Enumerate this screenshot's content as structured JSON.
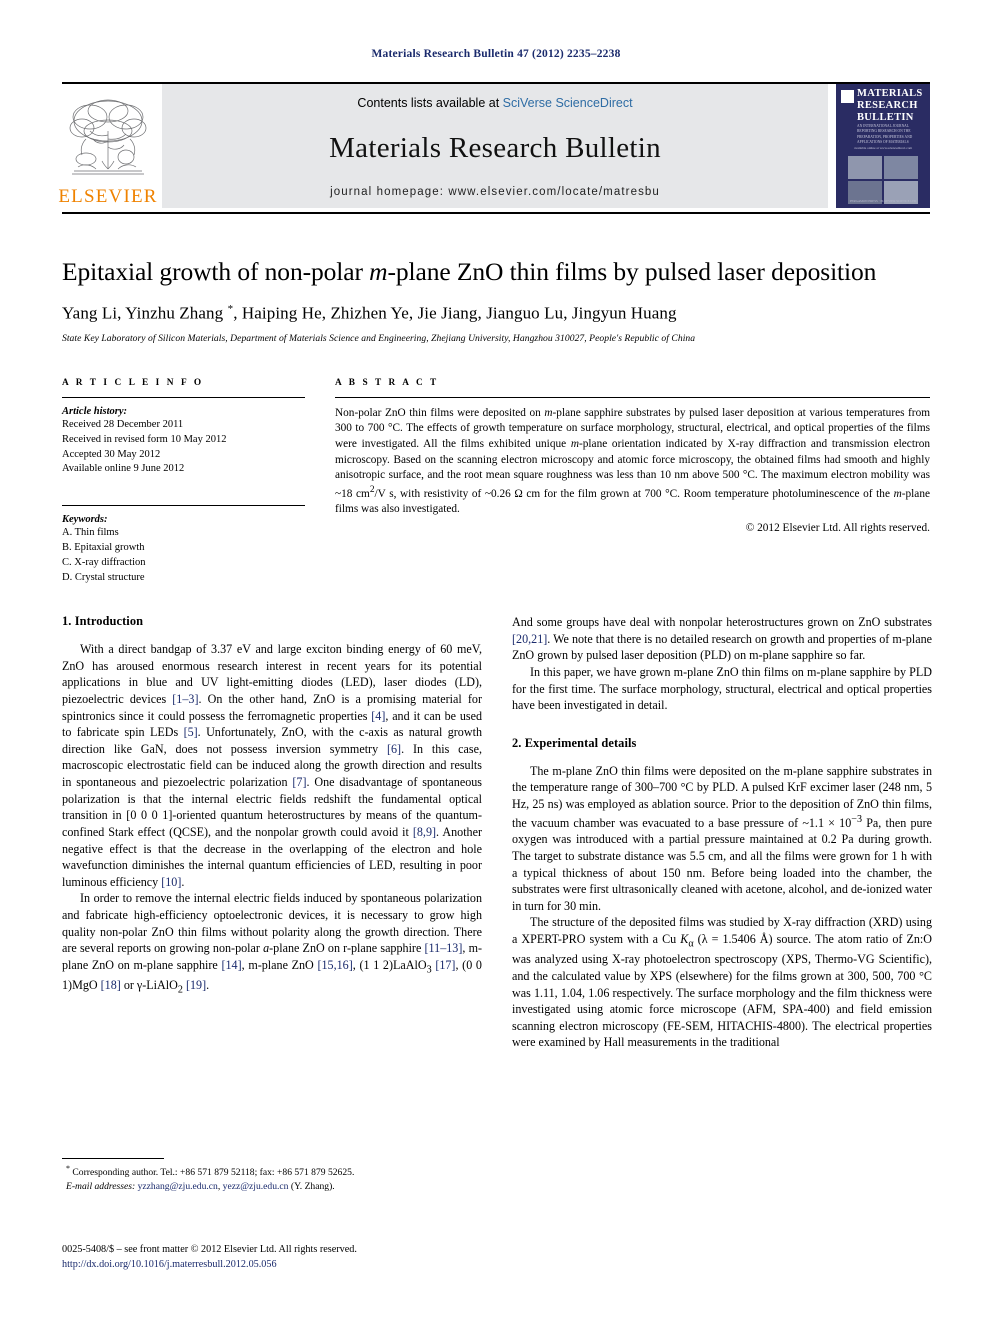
{
  "running_head": "Materials Research Bulletin 47 (2012) 2235–2238",
  "header": {
    "contents_prefix": "Contents lists available at ",
    "contents_link": "SciVerse ScienceDirect",
    "journal_title": "Materials Research Bulletin",
    "homepage": "journal homepage: www.elsevier.com/locate/matresbu",
    "publisher_logo_text": "ELSEVIER",
    "cover": {
      "title": "MATERIALS RESEARCH BULLETIN",
      "subtitle": "AN INTERNATIONAL JOURNAL REPORTING RESEARCH ON THE PREPARATION, PROPERTIES AND APPLICATIONS OF MATERIALS",
      "mid_caption": "available online at www.sciencedirect.com",
      "footer_caption": "PERGAMON PRESS · ELSEVIER SCIENCE LTD"
    }
  },
  "article": {
    "title_part1": "Epitaxial growth of non-polar ",
    "title_italic": "m",
    "title_part2": "-plane ZnO thin films by pulsed laser deposition",
    "authors": "Yang Li, Yinzhu Zhang ",
    "author_marker": "*",
    "authors_rest": ", Haiping He, Zhizhen Ye, Jie Jiang, Jianguo Lu, Jingyun Huang",
    "affiliation": "State Key Laboratory of Silicon Materials, Department of Materials Science and Engineering, Zhejiang University, Hangzhou 310027, People's Republic of China"
  },
  "article_info": {
    "label": "A R T I C L E   I N F O",
    "history_title": "Article history:",
    "history": [
      "Received 28 December 2011",
      "Received in revised form 10 May 2012",
      "Accepted 30 May 2012",
      "Available online 9 June 2012"
    ],
    "keywords_title": "Keywords:",
    "keywords": [
      "A. Thin films",
      "B. Epitaxial growth",
      "C. X-ray diffraction",
      "D. Crystal structure"
    ]
  },
  "abstract": {
    "label": "A B S T R A C T",
    "p1_a": "Non-polar ZnO thin films were deposited on ",
    "p1_i1": "m",
    "p1_b": "-plane sapphire substrates by pulsed laser deposition at various temperatures from 300 to 700 °C. The effects of growth temperature on surface morphology, structural, electrical, and optical properties of the films were investigated. All the films exhibited unique ",
    "p1_i2": "m",
    "p1_c": "-plane orientation indicated by X-ray diffraction and transmission electron microscopy. Based on the scanning electron microscopy and atomic force microscopy, the obtained films had smooth and highly anisotropic surface, and the root mean square roughness was less than 10 nm above 500 °C. The maximum electron mobility was ~18 cm",
    "p1_sup": "2",
    "p1_d": "/V s, with resistivity of ~0.26 Ω cm for the film grown at 700 °C. Room temperature photoluminescence of the ",
    "p1_i3": "m",
    "p1_e": "-plane films was also investigated.",
    "copyright": "© 2012 Elsevier Ltd. All rights reserved."
  },
  "sections": {
    "intro_heading": "1. Introduction",
    "experimental_heading": "2. Experimental details"
  },
  "body": {
    "intro_p1": {
      "a": "With a direct bandgap of 3.37 eV and large exciton binding energy of 60 meV, ZnO has aroused enormous research interest in recent years for its potential applications in blue and UV light-emitting diodes (LED), laser diodes (LD), piezoelectric devices ",
      "r1": "[1–3]",
      "b": ". On the other hand, ZnO is a promising material for spintronics since it could possess the ferromagnetic properties ",
      "r2": "[4]",
      "c": ", and it can be used to fabricate spin LEDs ",
      "r3": "[5]",
      "d": ". Unfortunately, ZnO, with the c-axis as natural growth direction like GaN, does not possess inversion symmetry ",
      "r4": "[6]",
      "e": ". In this case, macroscopic electrostatic field can be induced along the growth direction and results in spontaneous and piezoelectric polarization ",
      "r5": "[7]",
      "f": ". One disadvantage of spontaneous polarization is that the internal electric fields redshift the fundamental optical transition in [0 0 0 1]-oriented quantum heterostructures by means of the quantum-confined Stark effect (QCSE), and the nonpolar growth could avoid it ",
      "r6": "[8,9]",
      "g": ". Another negative effect is that the decrease in the overlapping of the electron and hole wavefunction diminishes the internal quantum efficiencies of LED, resulting in poor luminous efficiency ",
      "r7": "[10]",
      "h": "."
    },
    "intro_p2": {
      "a": "In order to remove the internal electric fields induced by spontaneous polarization and fabricate high-efficiency optoelectronic devices, it is necessary to grow high quality non-polar ZnO thin films without polarity along the growth direction. There are several reports on growing non-polar ",
      "i1": "a",
      "b": "-plane ZnO on r-plane sapphire ",
      "r1": "[11–13]",
      "c": ", m-plane ZnO on m-plane sapphire ",
      "r2": "[14]",
      "d": ", m-plane ZnO ",
      "r3": "[15,16]",
      "e": ", (1 1 2)LaAlO",
      "sub1": "3",
      "f": " ",
      "r4": "[17]",
      "g": ", (0 0 1)MgO ",
      "r5": "[18]",
      "h": " or γ-LiAlO",
      "sub2": "2",
      "i": " ",
      "r6": "[19]",
      "j": "."
    },
    "intro_p3": {
      "a": "And some groups have deal with nonpolar heterostructures grown on ZnO substrates ",
      "r1": "[20,21]",
      "b": ". We note that there is no detailed research on growth and properties of m-plane ZnO grown by pulsed laser deposition (PLD) on m-plane sapphire so far."
    },
    "intro_p4": {
      "a": "In this paper, we have grown m-plane ZnO thin films on m-plane sapphire by PLD for the first time. The surface morphology, structural, electrical and optical properties have been investigated in detail."
    },
    "exp_p1": {
      "a": "The m-plane ZnO thin films were deposited on the m-plane sapphire substrates in the temperature range of 300–700 °C by PLD. A pulsed KrF excimer laser (248 nm, 5 Hz, 25 ns) was employed as ablation source. Prior to the deposition of ZnO thin films, the vacuum chamber was evacuated to a base pressure of ~1.1 × 10",
      "sup1": "−3",
      "b": " Pa, then pure oxygen was introduced with a partial pressure maintained at 0.2 Pa during growth. The target to substrate distance was 5.5 cm, and all the films were grown for 1 h with a typical thickness of about 150 nm. Before being loaded into the chamber, the substrates were first ultrasonically cleaned with acetone, alcohol, and de-ionized water in turn for 30 min."
    },
    "exp_p2": {
      "a": "The structure of the deposited films was studied by X-ray diffraction (XRD) using a XPERT-PRO system with a Cu ",
      "i1": "K",
      "sub1": "α",
      "b": " (λ = 1.5406 Å) source. The atom ratio of Zn:O was analyzed using X-ray photoelectron spectroscopy (XPS, Thermo-VG Scientific), and the calculated value by XPS (elsewhere) for the films grown at 300, 500, 700 °C was 1.11, 1.04, 1.06 respectively. The surface morphology and the film thickness were investigated using atomic force microscope (AFM, SPA-400) and field emission scanning electron microscopy (FE-SEM, HITACHIS-4800). The electrical properties were examined by Hall measurements in the traditional"
    }
  },
  "footnote": {
    "marker": "*",
    "line1": " Corresponding author. Tel.: +86 571 879 52118; fax: +86 571 879 52625.",
    "email_label": "E-mail addresses:",
    "email1": "yzzhang@zju.edu.cn",
    "email_sep": ", ",
    "email2": "yezz@zju.edu.cn",
    "email_tail": " (Y. Zhang)."
  },
  "footer": {
    "issn_line": "0025-5408/$ – see front matter © 2012 Elsevier Ltd. All rights reserved.",
    "doi": "http://dx.doi.org/10.1016/j.materresbull.2012.05.056"
  },
  "colors": {
    "link_blue": "#1a2a6c",
    "sciencedirect_blue": "#2e6ca4",
    "elsevier_orange": "#ef8200",
    "cover_navy": "#2a2c63",
    "header_band_gray": "#e6e7e9"
  }
}
